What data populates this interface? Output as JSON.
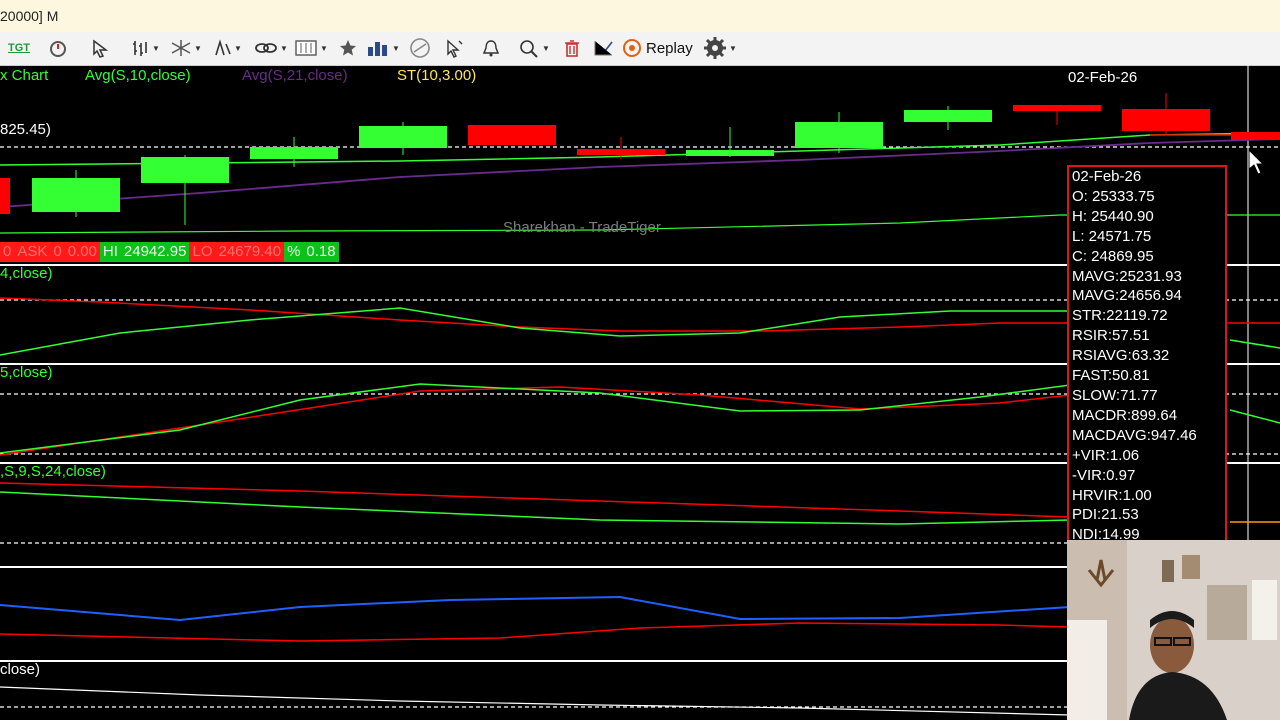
{
  "window": {
    "title": "20000] M"
  },
  "toolbar": {
    "tgt_label": "TGT",
    "replay_label": "Replay",
    "icons": [
      "indicator-icon",
      "pointer-icon",
      "bar-style-icon",
      "drawing-tools-icon",
      "fibonacci-icon",
      "link-icon",
      "template-icon",
      "favorite-star-icon",
      "chart-type-icon",
      "compass-icon",
      "cursor-icon",
      "alert-icon",
      "zoom-icon",
      "delete-icon",
      "trendline-icon",
      "replay-icon",
      "settings-gear-icon"
    ]
  },
  "chart": {
    "title": "x Chart",
    "overlays": [
      {
        "label": "Avg(S,10,close)",
        "color": "#33ff33"
      },
      {
        "label": "Avg(S,21,close)",
        "color": "#6a2c8c"
      },
      {
        "label": "ST(10,3.00)",
        "color": "#ffe65a"
      }
    ],
    "date_header": "02-Feb-26",
    "price_label": "825.45)",
    "watermark": "Sharekhan - TradeTiger",
    "quote_bar": {
      "first": "0",
      "ask_label": "ASK",
      "ask_qty": "0",
      "ask_price": "0.00",
      "hi_label": "HI",
      "hi_value": "24942.95",
      "lo_label": "LO",
      "lo_value": "24679.40",
      "pct_label": "%",
      "pct_value": "0.18"
    },
    "pane_labels": [
      "4,close)",
      "5,close)",
      ",S,9,S,24,close)",
      "close)"
    ],
    "colors": {
      "up": "#33ff33",
      "down": "#ff0000",
      "background": "#000000"
    }
  },
  "info_panel": {
    "rows": [
      "02-Feb-26",
      "O: 25333.75",
      "H: 25440.90",
      "L: 24571.75",
      "C: 24869.95",
      "MAVG:25231.93",
      "MAVG:24656.94",
      "STR:22119.72",
      "RSIR:57.51",
      "RSIAVG:63.32",
      "FAST:50.81",
      "SLOW:71.77",
      "MACDR:899.64",
      "MACDAVG:947.46",
      "+VIR:1.06",
      "-VIR:0.97",
      "HRVIR:1.00",
      "PDI:21.53",
      "NDI:14.99"
    ]
  }
}
